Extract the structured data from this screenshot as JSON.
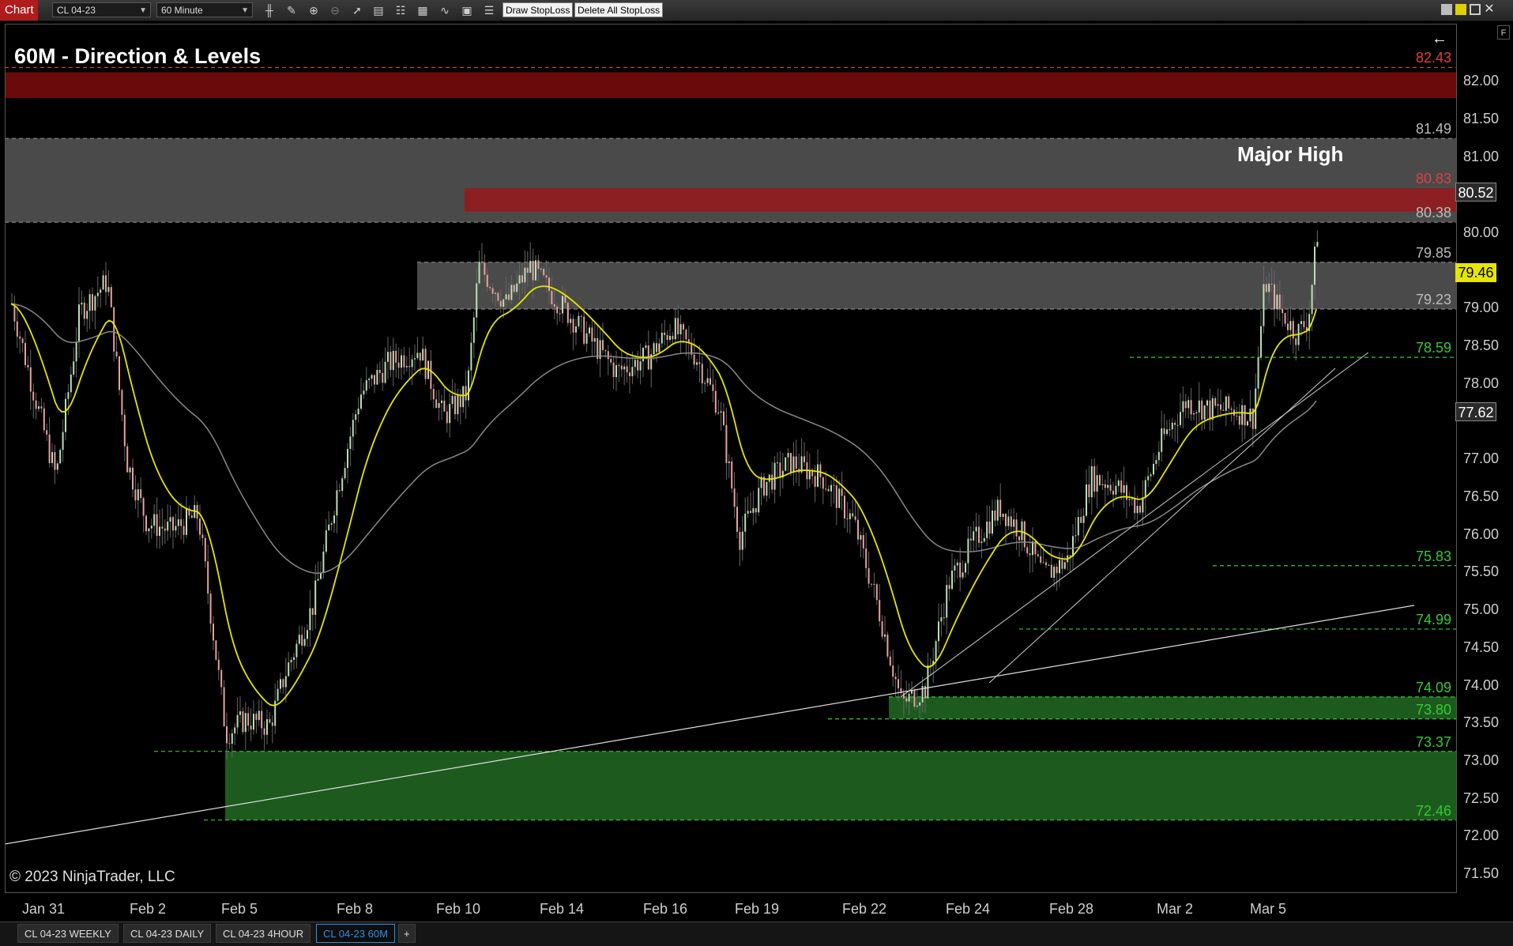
{
  "toolbar": {
    "chart_tab": "Chart",
    "instrument": "CL 04-23",
    "timeframe": "60 Minute",
    "draw_stoploss": "Draw StopLoss",
    "delete_stoploss": "Delete All StopLoss",
    "icons": [
      "bar-style-icon",
      "draw-pencil-icon",
      "zoom-in-icon",
      "zoom-out-icon",
      "pointer-icon",
      "data-box-icon",
      "properties-icon",
      "strategies-icon",
      "indicators-icon",
      "chart-trader-icon",
      "list-icon"
    ]
  },
  "chart": {
    "title": "60M - Direction & Levels",
    "annotation": "Major High",
    "copyright": "© 2023 NinjaTrader, LLC",
    "back_arrow": "←",
    "f_button": "F",
    "price_axis": [
      "82.00",
      "81.50",
      "81.00",
      "80.00",
      "79.00",
      "78.50",
      "78.00",
      "77.00",
      "76.50",
      "76.00",
      "75.50",
      "75.00",
      "74.50",
      "74.00",
      "73.50",
      "73.00",
      "72.50",
      "72.00",
      "71.50"
    ],
    "level_labels": [
      {
        "text": "82.43",
        "price": 82.43,
        "color": "#e04040"
      },
      {
        "text": "81.49",
        "price": 81.49,
        "color": "#bbbbbb"
      },
      {
        "text": "80.83",
        "price": 80.83,
        "color": "#e04040"
      },
      {
        "text": "80.38",
        "price": 80.38,
        "color": "#bbbbbb"
      },
      {
        "text": "79.85",
        "price": 79.85,
        "color": "#bbbbbb"
      },
      {
        "text": "79.23",
        "price": 79.23,
        "color": "#bbbbbb"
      },
      {
        "text": "78.59",
        "price": 78.59,
        "color": "#33cc33"
      },
      {
        "text": "75.83",
        "price": 75.83,
        "color": "#33cc33"
      },
      {
        "text": "74.99",
        "price": 74.99,
        "color": "#33cc33"
      },
      {
        "text": "74.09",
        "price": 74.09,
        "color": "#33cc33"
      },
      {
        "text": "73.80",
        "price": 73.8,
        "color": "#33cc33"
      },
      {
        "text": "73.37",
        "price": 73.37,
        "color": "#33cc33"
      },
      {
        "text": "72.46",
        "price": 72.46,
        "color": "#33cc33"
      }
    ],
    "last_price": "80.52",
    "ema_price": "79.46",
    "sma_price": "77.62",
    "time_axis": [
      "Jan 31",
      "Feb 2",
      "Feb 5",
      "Feb 8",
      "Feb 10",
      "Feb 14",
      "Feb 16",
      "Feb 19",
      "Feb 22",
      "Feb 24",
      "Feb 28",
      "Mar 2",
      "Mar 5"
    ],
    "colors": {
      "resistance_zone": "#8b1f22",
      "top_resistance": "#6b0a0a",
      "grey_zone": "#4a4a4a",
      "support_zone": "#1d5a1d",
      "support_line": "#33cc33",
      "ema": "#e6e600",
      "sma": "#888888",
      "candle_up": "#b8e0b8",
      "candle_down": "#e8a0a0"
    }
  },
  "tabs": [
    "CL 04-23 WEEKLY",
    "CL 04-23 DAILY",
    "CL 04-23 4HOUR",
    "CL 04-23 60M"
  ],
  "add_tab": "+"
}
